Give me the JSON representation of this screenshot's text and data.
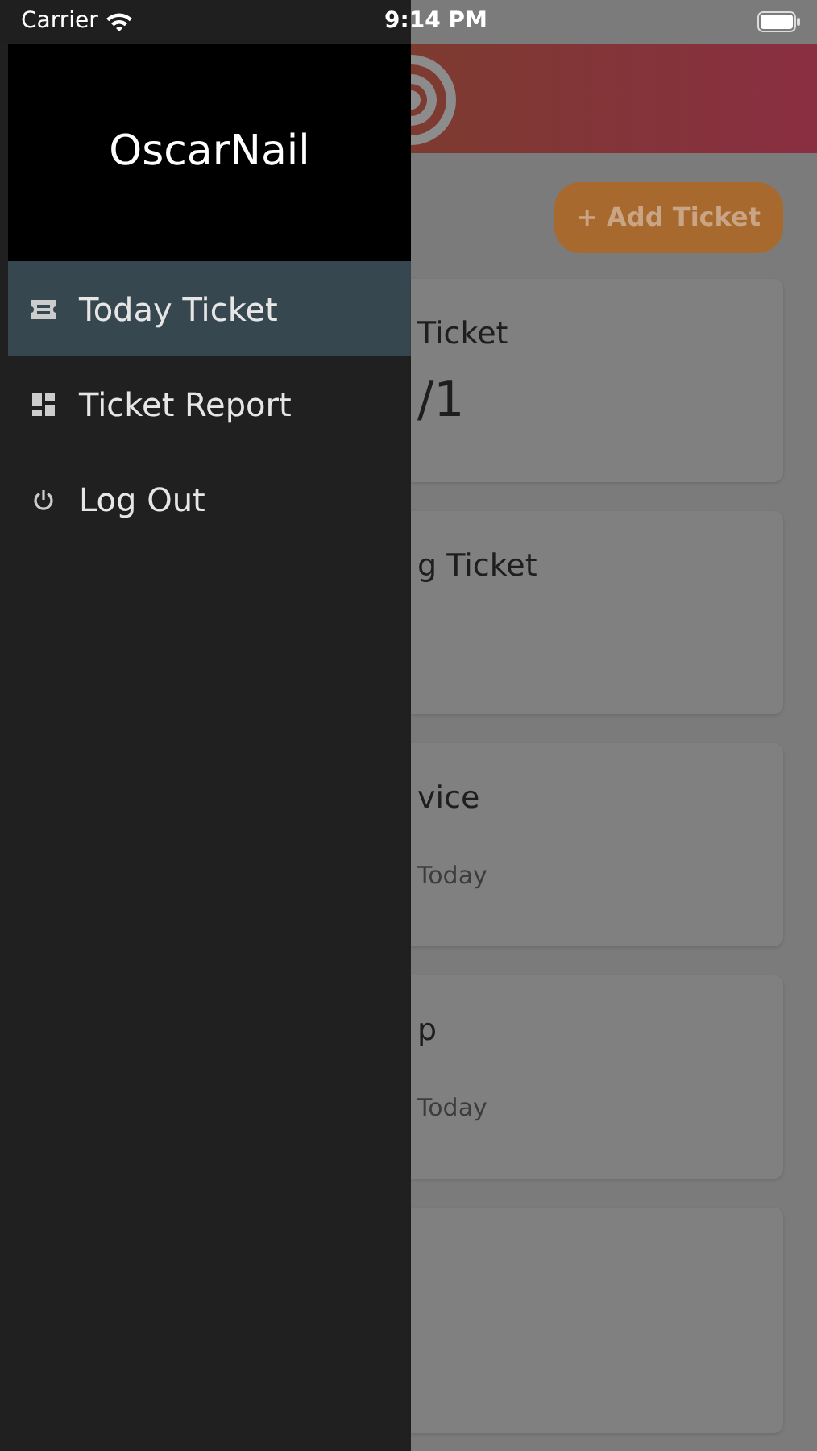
{
  "status_bar": {
    "carrier": "Carrier",
    "time": "9:14 PM"
  },
  "drawer": {
    "title": "OscarNail",
    "items": [
      {
        "label": "Today Ticket",
        "selected": true
      },
      {
        "label": "Ticket Report",
        "selected": false
      },
      {
        "label": "Log Out",
        "selected": false
      }
    ]
  },
  "background": {
    "add_button": "+ Add Ticket",
    "cards": [
      {
        "kind": "stat",
        "title": "Ticket",
        "value": "/1"
      },
      {
        "kind": "stat",
        "title": "g Ticket"
      },
      {
        "kind": "stat",
        "title": "vice",
        "subtitle": "Today"
      },
      {
        "kind": "stat",
        "title": "p",
        "subtitle": "Today"
      },
      {
        "kind": "blank"
      }
    ]
  }
}
